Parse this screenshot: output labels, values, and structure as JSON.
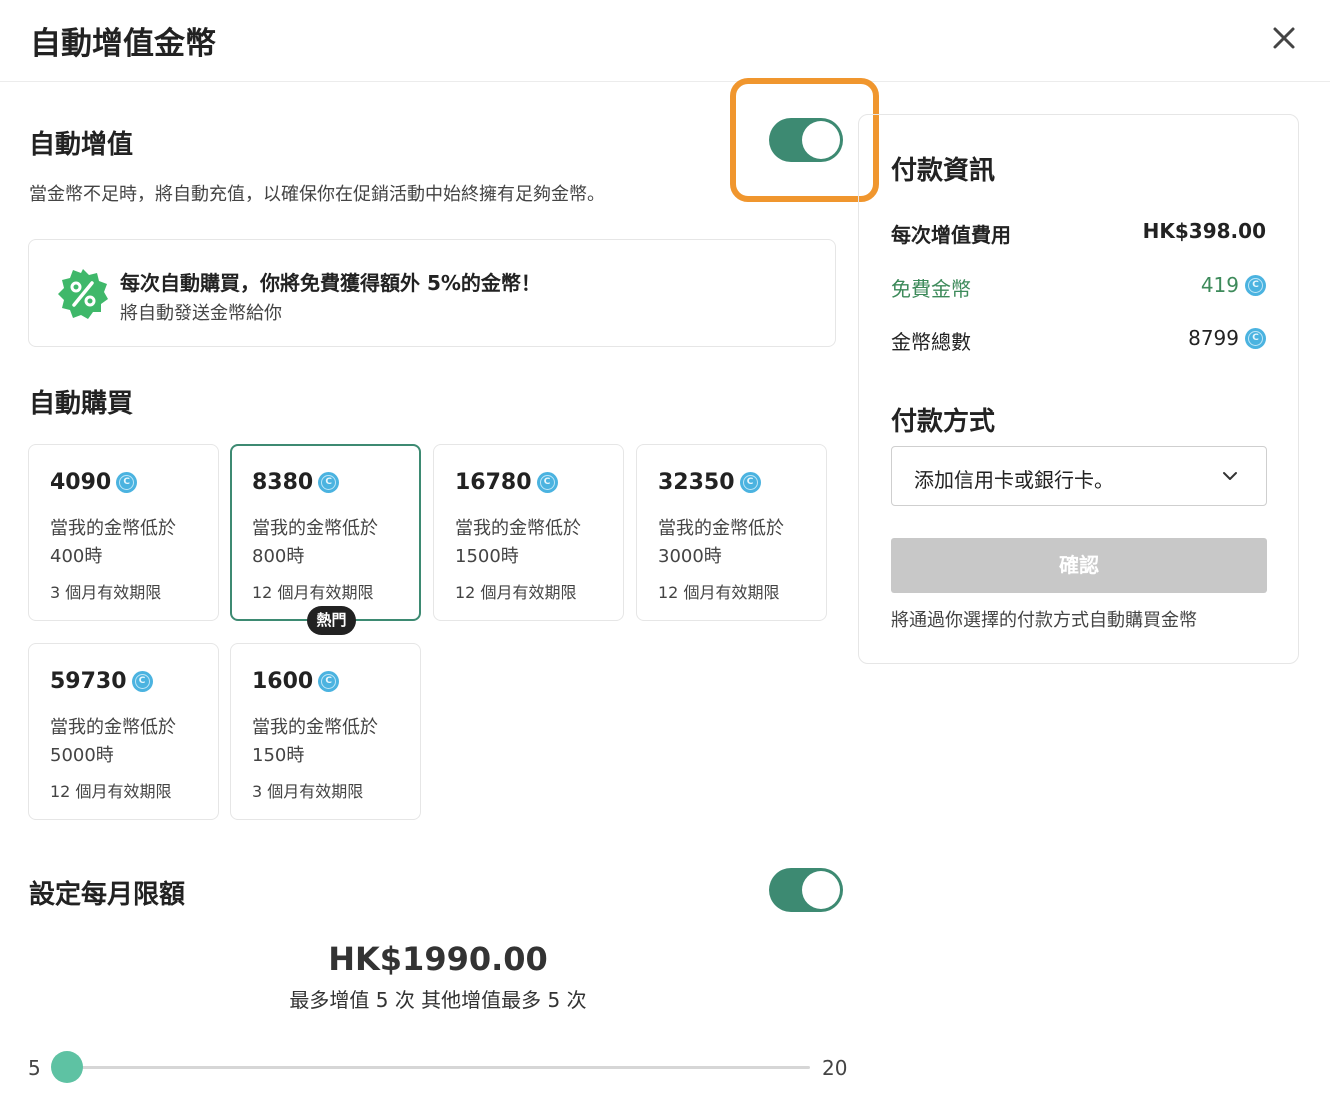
{
  "header": {
    "title": "自動增值金幣",
    "close_icon": "close-icon"
  },
  "auto_topup": {
    "title": "自動增值",
    "enabled": true,
    "description": "當金幣不足時，將自動充值，以確保你在促銷活動中始終擁有足夠金幣。"
  },
  "promo": {
    "badge_icon": "percent-badge-icon",
    "title": "每次自動購買，你將免費獲得額外 5%的金幣！",
    "subtitle": "將自動發送金幣給你"
  },
  "auto_buy": {
    "title": "自動購買",
    "selected_index": 1,
    "hot_label": "熱門",
    "cards": [
      {
        "amount": "4090",
        "condition": "當我的金幣低於400時",
        "validity": "3 個月有效期限"
      },
      {
        "amount": "8380",
        "condition": "當我的金幣低於800時",
        "validity": "12 個月有效期限"
      },
      {
        "amount": "16780",
        "condition": "當我的金幣低於1500時",
        "validity": "12 個月有效期限"
      },
      {
        "amount": "32350",
        "condition": "當我的金幣低於3000時",
        "validity": "12 個月有效期限"
      },
      {
        "amount": "59730",
        "condition": "當我的金幣低於5000時",
        "validity": "12 個月有效期限"
      },
      {
        "amount": "1600",
        "condition": "當我的金幣低於150時",
        "validity": "3 個月有效期限"
      }
    ]
  },
  "monthly_limit": {
    "title": "設定每月限額",
    "enabled": true,
    "amount": "HK$1990.00",
    "description": "最多增值 5 次 其他增值最多 5 次",
    "slider": {
      "min": "5",
      "max": "20",
      "value": 5
    }
  },
  "payment_info": {
    "title": "付款資訊",
    "rows": [
      {
        "label": "每次增值費用",
        "value": "HK$398.00"
      },
      {
        "label": "免費金幣",
        "value": "419"
      },
      {
        "label": "金幣總數",
        "value": "8799"
      }
    ]
  },
  "payment_method": {
    "title": "付款方式",
    "select_value": "添加信用卡或銀行卡。",
    "confirm_label": "確認",
    "note": "將通過你選擇的付款方式自動購買金幣"
  },
  "colors": {
    "accent": "#3d8a72",
    "highlight": "#f0962e",
    "coin": "#4bb3e0",
    "green_text": "#3d8a5a"
  }
}
